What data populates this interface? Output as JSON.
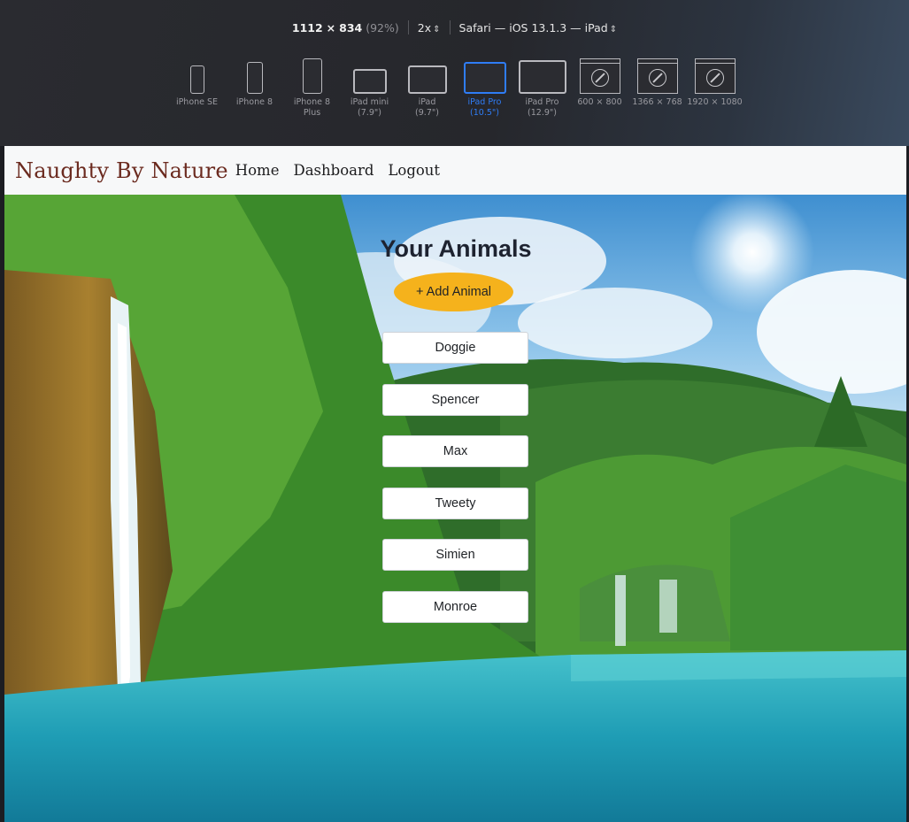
{
  "rdm_toolbar": {
    "width": "1112",
    "times": "×",
    "height": "834",
    "zoom": "(92%)",
    "scale": "2x",
    "browser": "Safari — iOS 13.1.3 — iPad",
    "devices": [
      {
        "line1": "iPhone SE",
        "line2": "",
        "kind": "phone",
        "selected": false
      },
      {
        "line1": "iPhone 8",
        "line2": "",
        "kind": "phone",
        "selected": false
      },
      {
        "line1": "iPhone 8",
        "line2": "Plus",
        "kind": "phone",
        "selected": false
      },
      {
        "line1": "iPad mini",
        "line2": "(7.9\")",
        "kind": "tablet",
        "selected": false
      },
      {
        "line1": "iPad",
        "line2": "(9.7\")",
        "kind": "tablet",
        "selected": false
      },
      {
        "line1": "iPad Pro",
        "line2": "(10.5\")",
        "kind": "tablet",
        "selected": true
      },
      {
        "line1": "iPad Pro",
        "line2": "(12.9\")",
        "kind": "tablet",
        "selected": false
      },
      {
        "line1": "600 × 800",
        "line2": "",
        "kind": "browser",
        "selected": false
      },
      {
        "line1": "1366 × 768",
        "line2": "",
        "kind": "browser",
        "selected": false
      },
      {
        "line1": "1920 × 1080",
        "line2": "",
        "kind": "browser",
        "selected": false
      }
    ]
  },
  "navbar": {
    "brand": "Naughty By Nature",
    "links": [
      "Home",
      "Dashboard",
      "Logout"
    ]
  },
  "main": {
    "heading": "Your Animals",
    "add_button": "+ Add Animal",
    "animals": [
      "Doggie",
      "Spencer",
      "Max",
      "Tweety",
      "Simien",
      "Monroe"
    ]
  },
  "colors": {
    "brand": "#6b2a1f",
    "add_button_bg": "#f5b21c",
    "selected_device": "#2f7df6"
  }
}
